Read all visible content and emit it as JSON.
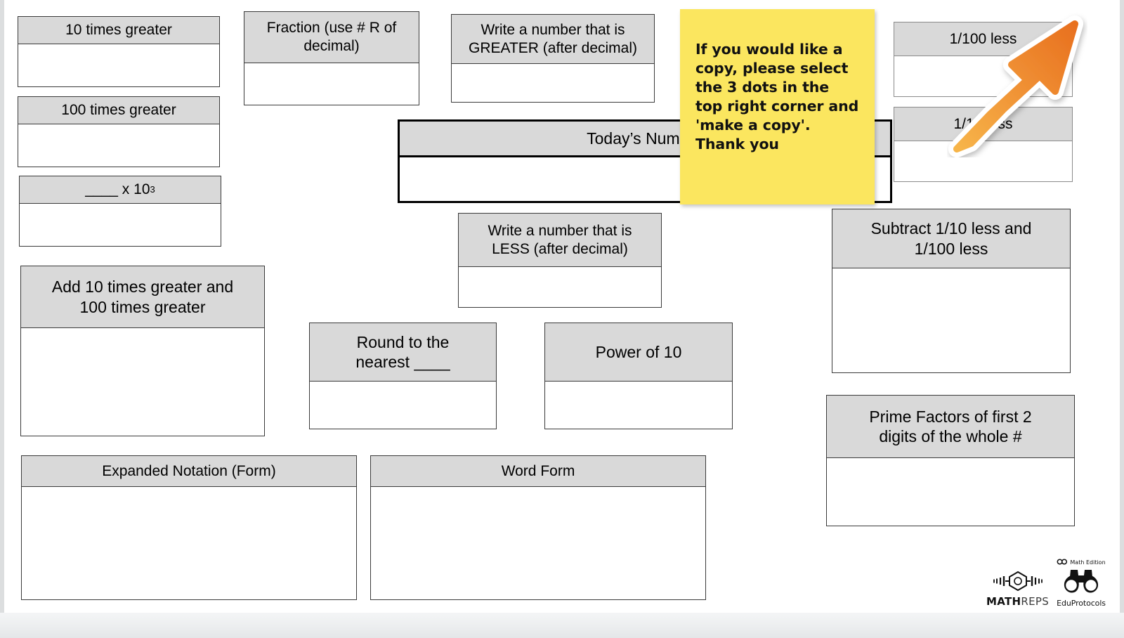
{
  "document": {
    "title_box": {
      "label": "Today’s Number"
    },
    "boxes": [
      {
        "id": "ten-times-greater",
        "label": "10 times greater"
      },
      {
        "id": "hundred-times-greater",
        "label": "100 times greater"
      },
      {
        "id": "blank-times-ten-cubed",
        "label": "____ x 10",
        "exponent": "3"
      },
      {
        "id": "add-10-and-100-times-greater",
        "label": "Add 10 times greater and\n100 times greater"
      },
      {
        "id": "expanded-notation-form",
        "label": "Expanded Notation (Form)"
      },
      {
        "id": "fraction-use-r-of-decimal",
        "label": "Fraction (use # R of\ndecimal)"
      },
      {
        "id": "write-number-greater",
        "label": "Write a number that is\nGREATER (after decimal)"
      },
      {
        "id": "write-number-less",
        "label": "Write a number that is\nLESS (after decimal)"
      },
      {
        "id": "round-to-nearest",
        "label": "Round to the\nnearest ____"
      },
      {
        "id": "power-of-10",
        "label": "Power of 10"
      },
      {
        "id": "word-form",
        "label": "Word Form"
      },
      {
        "id": "one-hundredth-less",
        "label": "1/100 less"
      },
      {
        "id": "one-tenth-less",
        "label": "1/10 less"
      },
      {
        "id": "subtract-tenth-and-hundredth",
        "label": "Subtract 1/10 less and\n1/100 less"
      },
      {
        "id": "prime-factors",
        "label": "Prime Factors of first 2\ndigits of the whole #"
      }
    ]
  },
  "sticky_note": {
    "text": "If you would like a copy, please select the 3 dots in the top right corner and 'make a copy'. Thank you",
    "color": "#fbe65f"
  },
  "arrow": {
    "name": "orange-arrow-up-right",
    "color_start": "#f5a93f",
    "color_end": "#ea7524",
    "outline": "#ffffff"
  },
  "logos": {
    "mathreps": {
      "bold_part": "MATH",
      "light_part": "REPS"
    },
    "eduprotocols": {
      "tagline": "Math Edition",
      "name": "EduProtocols"
    }
  },
  "colors": {
    "header_fill": "#d9d9d9",
    "border": "#3a3a3a",
    "emphasis_border": "#000000",
    "page_background": "#ffffff"
  }
}
